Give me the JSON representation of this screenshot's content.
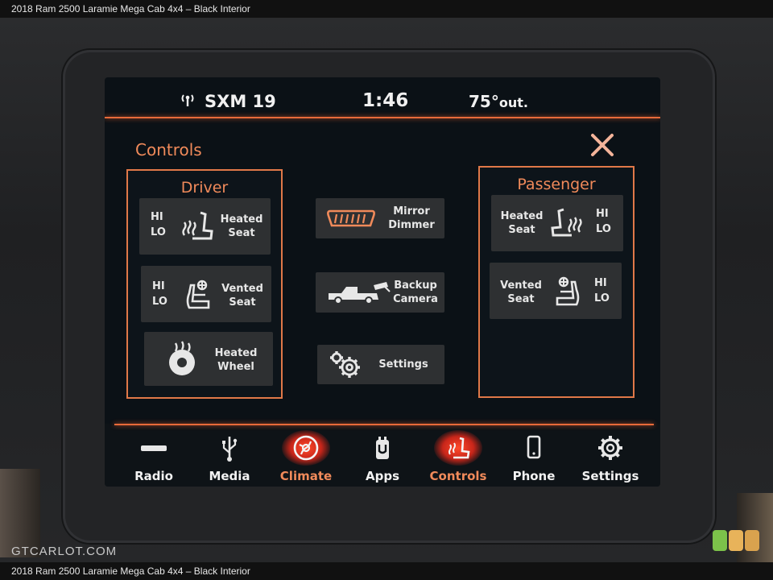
{
  "caption": {
    "top": "2018 Ram 2500 Laramie Mega Cab 4x4 – Black Interior",
    "bottom": "2018 Ram 2500 Laramie Mega Cab 4x4 – Black Interior"
  },
  "watermark": "GTCARLOT.COM",
  "status": {
    "source": "SXM 19",
    "time": "1:46",
    "temp_value": "75°",
    "temp_unit": "out."
  },
  "page_title": "Controls",
  "driver": {
    "title": "Driver",
    "heated_seat": {
      "hi": "HI",
      "lo": "LO",
      "line1": "Heated",
      "line2": "Seat"
    },
    "vented_seat": {
      "hi": "HI",
      "lo": "LO",
      "line1": "Vented",
      "line2": "Seat"
    },
    "heated_wheel": {
      "line1": "Heated",
      "line2": "Wheel"
    }
  },
  "center": {
    "mirror": {
      "line1": "Mirror",
      "line2": "Dimmer"
    },
    "camera": {
      "line1": "Backup",
      "line2": "Camera"
    },
    "settings": {
      "label": "Settings"
    }
  },
  "passenger": {
    "title": "Passenger",
    "heated_seat": {
      "hi": "HI",
      "lo": "LO",
      "line1": "Heated",
      "line2": "Seat"
    },
    "vented_seat": {
      "hi": "HI",
      "lo": "LO",
      "line1": "Vented",
      "line2": "Seat"
    }
  },
  "nav": [
    {
      "label": "Radio",
      "icon": "radio-icon",
      "active": false
    },
    {
      "label": "Media",
      "icon": "usb-icon",
      "active": false
    },
    {
      "label": "Climate",
      "icon": "climate-icon",
      "active": true
    },
    {
      "label": "Apps",
      "icon": "apps-icon",
      "active": false
    },
    {
      "label": "Controls",
      "icon": "controls-icon",
      "active": true
    },
    {
      "label": "Phone",
      "icon": "phone-icon",
      "active": false
    },
    {
      "label": "Settings",
      "icon": "gear-icon",
      "active": false
    }
  ],
  "colors": {
    "accent": "#e86a3a",
    "accent_text": "#f08a5a",
    "button_bg": "#2e3032",
    "screen_bg": "#0b1116"
  }
}
